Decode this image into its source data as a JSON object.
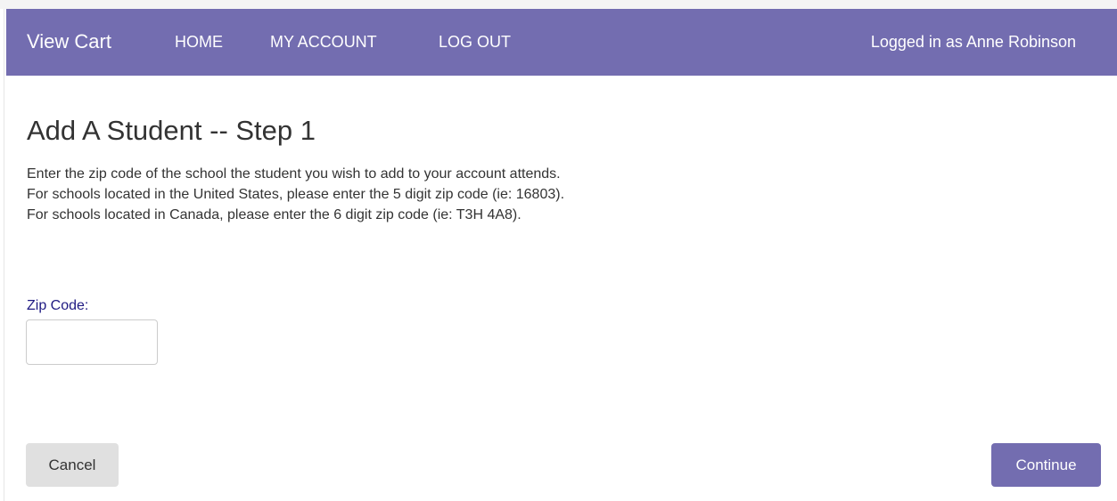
{
  "navbar": {
    "brand": "View Cart",
    "links": [
      "HOME",
      "MY ACCOUNT",
      "LOG OUT"
    ],
    "user_status": "Logged in as Anne Robinson"
  },
  "main": {
    "title": "Add A Student -- Step 1",
    "instructions": [
      "Enter the zip code of the school the student you wish to add to your account attends.",
      "For schools located in the United States, please enter the 5 digit zip code (ie: 16803).",
      "For schools located in Canada, please enter the 6 digit zip code (ie: T3H 4A8)."
    ],
    "zip_label": "Zip Code:",
    "zip_value": ""
  },
  "actions": {
    "cancel_label": "Cancel",
    "continue_label": "Continue"
  },
  "colors": {
    "brand": "#736db0",
    "label": "#1f1a82",
    "cancel_bg": "#e0e0e0"
  }
}
